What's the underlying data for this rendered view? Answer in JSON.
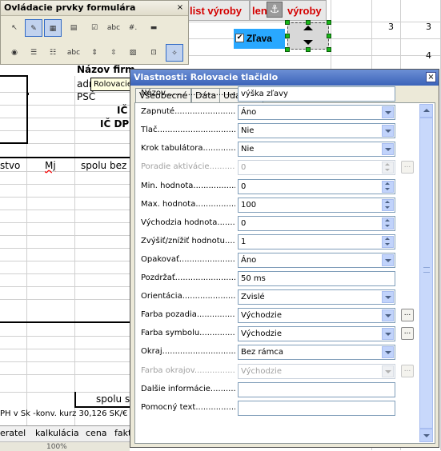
{
  "spreadsheet": {
    "header_buttons": [
      "list výroby",
      "len",
      "výroby"
    ],
    "checkbox_label": "Zľava",
    "numbers": [
      "3",
      "3",
      "4"
    ],
    "cells": {
      "nazov_firmy": "Názov firm",
      "adresa": "adr",
      "psc": "PSČ",
      "ico": "IČ",
      "ic_dph": "IČ DP",
      "col_mnozstvo": "stvo",
      "col_mj": "Mj",
      "col_spolu": "spolu bez",
      "spolu": "spolu s",
      "footer_note": "PH v Sk -konv. kurz 30,126 SK/€"
    },
    "sheet_tabs": [
      "eratel",
      "kalkulácia",
      "cena",
      "fakt"
    ],
    "bottom_value": "100%"
  },
  "toolbar": {
    "title": "Ovládacie prvky formulára",
    "close_label": "×",
    "buttons": [
      {
        "icon": "select-arrow-icon",
        "glyph": "↖"
      },
      {
        "icon": "design-mode-icon",
        "glyph": "✎"
      },
      {
        "icon": "control-properties-icon",
        "glyph": "▦"
      },
      {
        "icon": "form-properties-icon",
        "glyph": "▤"
      },
      {
        "icon": "checkbox-icon",
        "glyph": "☑"
      },
      {
        "icon": "text-box-icon",
        "glyph": "abc"
      },
      {
        "icon": "formatted-field-icon",
        "glyph": "#."
      },
      {
        "icon": "push-button-icon",
        "glyph": "▬"
      },
      {
        "icon": "option-button-icon",
        "glyph": "◉"
      },
      {
        "icon": "list-box-icon",
        "glyph": "☰"
      },
      {
        "icon": "combo-box-icon",
        "glyph": "☷"
      },
      {
        "icon": "label-icon",
        "glyph": "abc"
      },
      {
        "icon": "spin-button-icon",
        "glyph": "⇕"
      },
      {
        "icon": "scrollbar-icon",
        "glyph": "⇳"
      },
      {
        "icon": "image-button-icon",
        "glyph": "▨"
      },
      {
        "icon": "group-box-icon",
        "glyph": "⊡"
      },
      {
        "icon": "wizard-icon",
        "glyph": "✧"
      }
    ]
  },
  "tooltip": "Rolovacie tlačidlo",
  "dialog": {
    "title": "Vlastnosti: Rolovacie tlačidlo",
    "close_label": "×",
    "tabs": [
      "Všeobecné",
      "Dáta",
      "Udalosti"
    ],
    "properties": [
      {
        "label": "Názov.............................",
        "value": "výška zľavy",
        "type": "text",
        "enabled": true
      },
      {
        "label": "Zapnuté............................",
        "value": "Áno",
        "type": "dropdown",
        "enabled": true
      },
      {
        "label": "Tlač..................................",
        "value": "Nie",
        "type": "dropdown",
        "enabled": true
      },
      {
        "label": "Krok tabulátora...............",
        "value": "Nie",
        "type": "dropdown",
        "enabled": true
      },
      {
        "label": "Poradie aktivácie...............",
        "value": "0",
        "type": "spin",
        "enabled": false,
        "dots": true
      },
      {
        "label": "Min. hodnota.....................",
        "value": "0",
        "type": "spin",
        "enabled": true
      },
      {
        "label": "Max. hodnota.....................",
        "value": "100",
        "type": "spin",
        "enabled": true
      },
      {
        "label": "Východzia hodnota..............",
        "value": "0",
        "type": "spin",
        "enabled": true
      },
      {
        "label": "Zvýšiť/znížiť hodnotu.........",
        "value": "1",
        "type": "spin",
        "enabled": true
      },
      {
        "label": "Opakovať..........................",
        "value": "Áno",
        "type": "dropdown",
        "enabled": true
      },
      {
        "label": "Pozdržať...........................",
        "value": "50 ms",
        "type": "text",
        "enabled": true
      },
      {
        "label": "Orientácia.........................",
        "value": "Zvislé",
        "type": "dropdown",
        "enabled": true
      },
      {
        "label": "Farba pozadia....................",
        "value": "Východzie",
        "type": "dropdown",
        "enabled": true,
        "dots": true
      },
      {
        "label": "Farba symbolu...................",
        "value": "Východzie",
        "type": "dropdown",
        "enabled": true,
        "dots": true
      },
      {
        "label": "Okraj...............................",
        "value": "Bez rámca",
        "type": "dropdown",
        "enabled": true
      },
      {
        "label": "Farba okrajov.....................",
        "value": "Východzie",
        "type": "dropdown",
        "enabled": false,
        "dots": true
      },
      {
        "label": "Ďalšie informácie...............",
        "value": "",
        "type": "text",
        "enabled": true
      },
      {
        "label": "Pomocný text....................",
        "value": "",
        "type": "text",
        "enabled": true
      }
    ]
  }
}
